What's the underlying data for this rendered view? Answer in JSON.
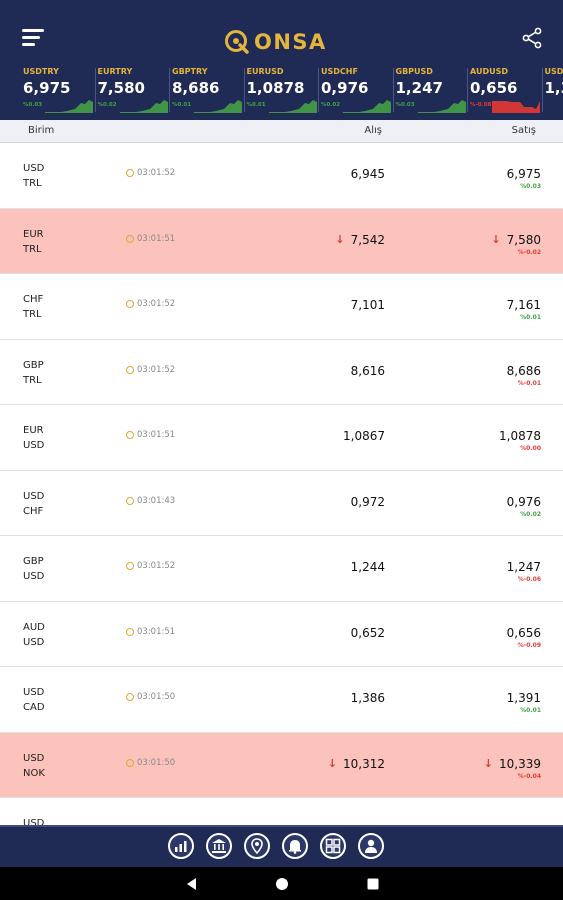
{
  "app": {
    "logo_text": "ONSA"
  },
  "ticker": [
    {
      "symbol": "USDTRY",
      "value": "6,975",
      "change": "%0.03",
      "trend": "up"
    },
    {
      "symbol": "EURTRY",
      "value": "7,580",
      "change": "%0.02",
      "trend": "up"
    },
    {
      "symbol": "GBPTRY",
      "value": "8,686",
      "change": "%0.01",
      "trend": "up"
    },
    {
      "symbol": "EURUSD",
      "value": "1,0878",
      "change": "%0.01",
      "trend": "up"
    },
    {
      "symbol": "USDCHF",
      "value": "0,976",
      "change": "%0.02",
      "trend": "up"
    },
    {
      "symbol": "GBPUSD",
      "value": "1,247",
      "change": "%0.03",
      "trend": "up"
    },
    {
      "symbol": "AUDUSD",
      "value": "0,656",
      "change": "%-0.08",
      "trend": "down"
    },
    {
      "symbol": "USDCAD",
      "value": "1,3",
      "change": "",
      "trend": "up"
    }
  ],
  "table": {
    "headers": {
      "currency": "Birim",
      "bid": "Alış",
      "ask": "Satış"
    },
    "rows": [
      {
        "base": "USD",
        "quote": "TRL",
        "time": "03:01:52",
        "bid": "6,945",
        "ask": "6,975",
        "pct": "%0.03",
        "dir": "up",
        "highlight": false
      },
      {
        "base": "EUR",
        "quote": "TRL",
        "time": "03:01:51",
        "bid": "7,542",
        "ask": "7,580",
        "pct": "%-0.02",
        "dir": "down",
        "highlight": true
      },
      {
        "base": "CHF",
        "quote": "TRL",
        "time": "03:01:52",
        "bid": "7,101",
        "ask": "7,161",
        "pct": "%0.01",
        "dir": "up",
        "highlight": false
      },
      {
        "base": "GBP",
        "quote": "TRL",
        "time": "03:01:52",
        "bid": "8,616",
        "ask": "8,686",
        "pct": "%-0.01",
        "dir": "down",
        "highlight": false
      },
      {
        "base": "EUR",
        "quote": "USD",
        "time": "03:01:51",
        "bid": "1,0867",
        "ask": "1,0878",
        "pct": "%0.00",
        "dir": "down",
        "highlight": false
      },
      {
        "base": "USD",
        "quote": "CHF",
        "time": "03:01:43",
        "bid": "0,972",
        "ask": "0,976",
        "pct": "%0.02",
        "dir": "up",
        "highlight": false
      },
      {
        "base": "GBP",
        "quote": "USD",
        "time": "03:01:52",
        "bid": "1,244",
        "ask": "1,247",
        "pct": "%-0.06",
        "dir": "down",
        "highlight": false
      },
      {
        "base": "AUD",
        "quote": "USD",
        "time": "03:01:51",
        "bid": "0,652",
        "ask": "0,656",
        "pct": "%-0.09",
        "dir": "down",
        "highlight": false
      },
      {
        "base": "USD",
        "quote": "CAD",
        "time": "03:01:50",
        "bid": "1,386",
        "ask": "1,391",
        "pct": "%0.01",
        "dir": "up",
        "highlight": false
      },
      {
        "base": "USD",
        "quote": "NOK",
        "time": "03:01:50",
        "bid": "10,312",
        "ask": "10,339",
        "pct": "%-0.04",
        "dir": "down",
        "highlight": true
      },
      {
        "base": "USD",
        "quote": "",
        "time": "",
        "bid": "",
        "ask": "",
        "pct": "",
        "dir": "up",
        "highlight": false
      }
    ]
  },
  "bottom_nav": [
    "chart-icon",
    "bank-icon",
    "location-icon",
    "bell-icon",
    "grid-icon",
    "user-icon"
  ],
  "colors": {
    "navy": "#1f2a55",
    "gold": "#e4b53c",
    "up": "#43a047",
    "down": "#e53935",
    "highlight": "#fbc3bb"
  }
}
